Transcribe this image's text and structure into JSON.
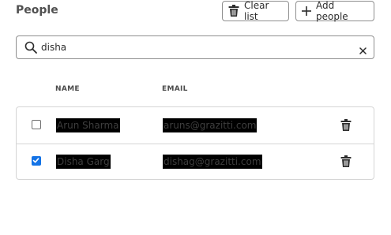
{
  "header": {
    "title": "People",
    "clear_label": "Clear list",
    "add_label": "Add people"
  },
  "search": {
    "value": "disha",
    "icon": "search-icon",
    "clear_icon": "close-icon"
  },
  "table": {
    "columns": [
      "NAME",
      "EMAIL"
    ],
    "rows": [
      {
        "name": "Arun Sharma",
        "email": "aruns@grazitti.com",
        "checked": false
      },
      {
        "name": "Disha Garg",
        "email": "dishag@grazitti.com",
        "checked": true
      }
    ]
  },
  "colors": {
    "accent": "#1473e6",
    "border": "#8f8f8f",
    "divider": "#d5d5d5",
    "redaction": "#000000"
  }
}
